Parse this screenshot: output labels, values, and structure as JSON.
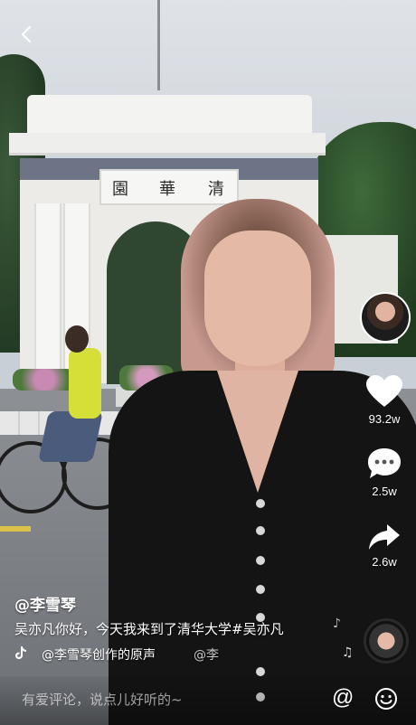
{
  "video": {
    "plaque_chars": [
      "清",
      "華",
      "園"
    ]
  },
  "sidebar": {
    "likes": "93.2w",
    "comments": "2.5w",
    "shares": "2.6w"
  },
  "post": {
    "author": "@李雪琴",
    "caption": "吴亦凡你好，今天我来到了清华大学#吴亦凡",
    "music": "@李雪琴创作的原声",
    "music_scroll": "@李"
  },
  "comment_bar": {
    "placeholder": "有爱评论，说点儿好听的~",
    "at_label": "@"
  },
  "icons": {
    "back": "chevron-left-icon",
    "like": "heart-icon",
    "comment": "speech-bubble-icon",
    "share": "share-arrow-icon",
    "music": "tiktok-note-icon",
    "emoji": "smiley-icon"
  }
}
